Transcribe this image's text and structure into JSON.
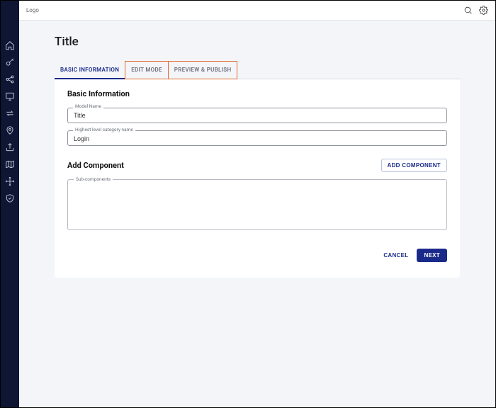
{
  "topbar": {
    "logo": "Logo"
  },
  "page": {
    "title": "Title"
  },
  "tabs": {
    "basic": "BASIC INFORMATION",
    "edit": "EDIT MODE",
    "preview": "PREVIEW & PUBLISH"
  },
  "sections": {
    "basic_info_title": "Basic Information",
    "model_name": {
      "label": "Model Name",
      "value": "Title"
    },
    "category": {
      "label": "Highest level category name",
      "value": "Login"
    },
    "add_component_title": "Add Component",
    "add_component_btn": "ADD COMPONENT",
    "subcomponents_label": "Sub-components"
  },
  "footer": {
    "cancel": "CANCEL",
    "next": "NEXT"
  }
}
